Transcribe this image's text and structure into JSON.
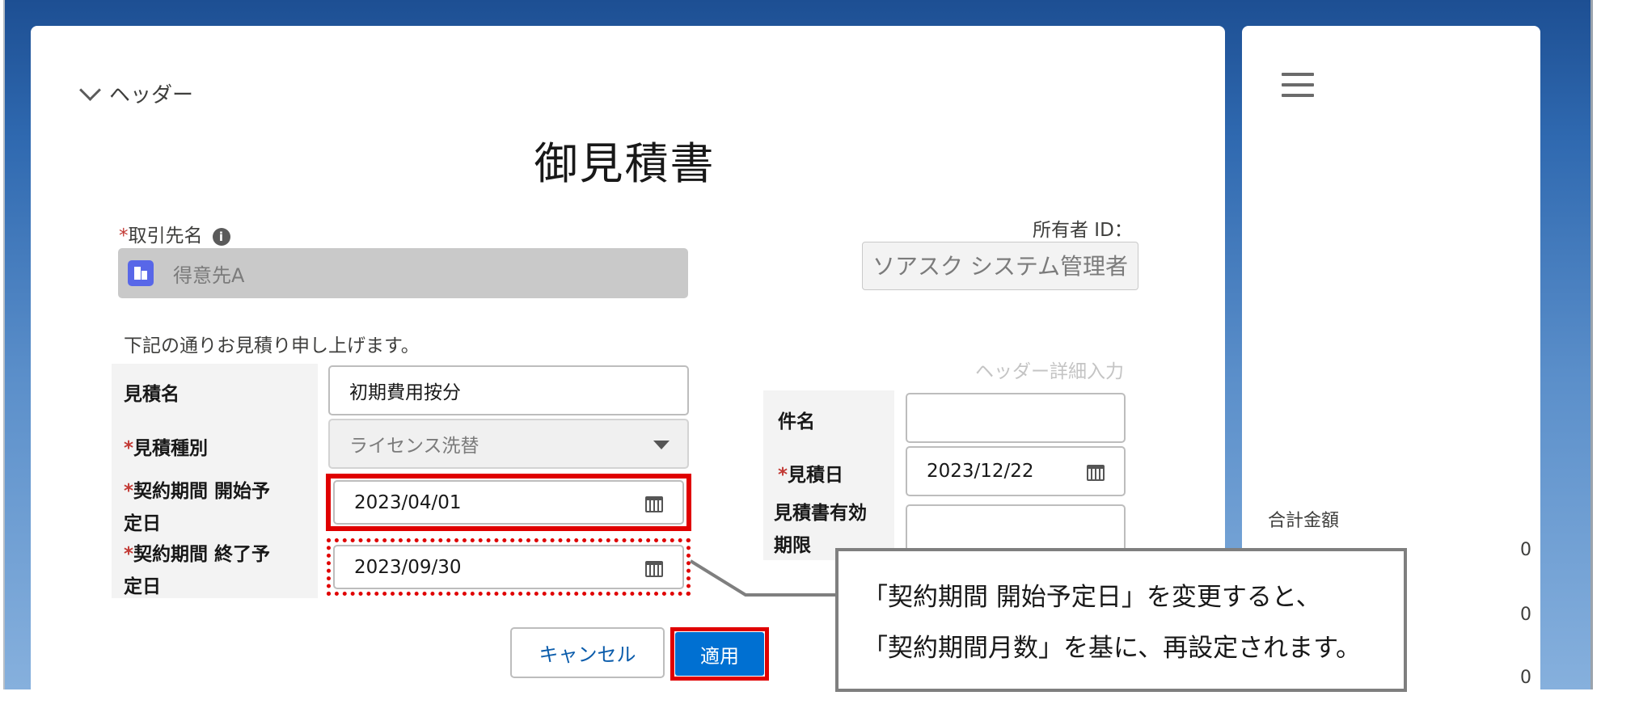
{
  "header_section": {
    "toggle_label": "ヘッダー"
  },
  "document_title": "御見積書",
  "account": {
    "label": "取引先名",
    "value": "得意先A",
    "required_mark": "*"
  },
  "owner": {
    "label": "所有者 ID：",
    "value": "ソアスク システム管理者"
  },
  "intro_text": "下記の通りお見積り申し上げます。",
  "detail_link": "ヘッダー詳細入力",
  "left_form": {
    "quote_name_label": "見積名",
    "quote_name_value": "初期費用按分",
    "quote_type_label": "見積種別",
    "quote_type_value": "ライセンス洗替",
    "start_date_label_1": "契約期間 開始予",
    "start_date_label_2": "定日",
    "start_date_value": "2023/04/01",
    "end_date_label_1": "契約期間 終了予",
    "end_date_label_2": "定日",
    "end_date_value": "2023/09/30"
  },
  "right_form": {
    "subject_label": "件名",
    "subject_value": "",
    "quote_date_label": "見積日",
    "quote_date_value": "2023/12/22",
    "validity_label_1": "見積書有効",
    "validity_label_2": "期限",
    "validity_value": ""
  },
  "buttons": {
    "cancel": "キャンセル",
    "apply": "適用"
  },
  "callout": {
    "line1": "「契約期間 開始予定日」を変更すると、",
    "line2": "「契約期間月数」を基に、再設定されます。"
  },
  "side_panel": {
    "total_label": "合計金額",
    "values": [
      "0",
      "0",
      "0"
    ]
  },
  "colors": {
    "accent": "#0070d2",
    "highlight": "#e00000",
    "required": "#c23934"
  }
}
